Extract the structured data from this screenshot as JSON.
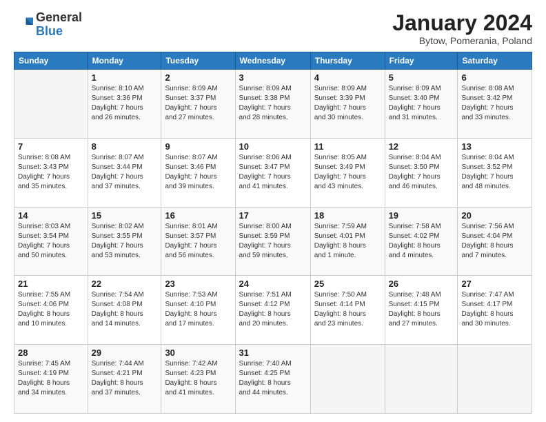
{
  "header": {
    "logo_general": "General",
    "logo_blue": "Blue",
    "month_title": "January 2024",
    "subtitle": "Bytow, Pomerania, Poland"
  },
  "weekdays": [
    "Sunday",
    "Monday",
    "Tuesday",
    "Wednesday",
    "Thursday",
    "Friday",
    "Saturday"
  ],
  "weeks": [
    [
      {
        "day": "",
        "detail": ""
      },
      {
        "day": "1",
        "detail": "Sunrise: 8:10 AM\nSunset: 3:36 PM\nDaylight: 7 hours\nand 26 minutes."
      },
      {
        "day": "2",
        "detail": "Sunrise: 8:09 AM\nSunset: 3:37 PM\nDaylight: 7 hours\nand 27 minutes."
      },
      {
        "day": "3",
        "detail": "Sunrise: 8:09 AM\nSunset: 3:38 PM\nDaylight: 7 hours\nand 28 minutes."
      },
      {
        "day": "4",
        "detail": "Sunrise: 8:09 AM\nSunset: 3:39 PM\nDaylight: 7 hours\nand 30 minutes."
      },
      {
        "day": "5",
        "detail": "Sunrise: 8:09 AM\nSunset: 3:40 PM\nDaylight: 7 hours\nand 31 minutes."
      },
      {
        "day": "6",
        "detail": "Sunrise: 8:08 AM\nSunset: 3:42 PM\nDaylight: 7 hours\nand 33 minutes."
      }
    ],
    [
      {
        "day": "7",
        "detail": "Sunrise: 8:08 AM\nSunset: 3:43 PM\nDaylight: 7 hours\nand 35 minutes."
      },
      {
        "day": "8",
        "detail": "Sunrise: 8:07 AM\nSunset: 3:44 PM\nDaylight: 7 hours\nand 37 minutes."
      },
      {
        "day": "9",
        "detail": "Sunrise: 8:07 AM\nSunset: 3:46 PM\nDaylight: 7 hours\nand 39 minutes."
      },
      {
        "day": "10",
        "detail": "Sunrise: 8:06 AM\nSunset: 3:47 PM\nDaylight: 7 hours\nand 41 minutes."
      },
      {
        "day": "11",
        "detail": "Sunrise: 8:05 AM\nSunset: 3:49 PM\nDaylight: 7 hours\nand 43 minutes."
      },
      {
        "day": "12",
        "detail": "Sunrise: 8:04 AM\nSunset: 3:50 PM\nDaylight: 7 hours\nand 46 minutes."
      },
      {
        "day": "13",
        "detail": "Sunrise: 8:04 AM\nSunset: 3:52 PM\nDaylight: 7 hours\nand 48 minutes."
      }
    ],
    [
      {
        "day": "14",
        "detail": "Sunrise: 8:03 AM\nSunset: 3:54 PM\nDaylight: 7 hours\nand 50 minutes."
      },
      {
        "day": "15",
        "detail": "Sunrise: 8:02 AM\nSunset: 3:55 PM\nDaylight: 7 hours\nand 53 minutes."
      },
      {
        "day": "16",
        "detail": "Sunrise: 8:01 AM\nSunset: 3:57 PM\nDaylight: 7 hours\nand 56 minutes."
      },
      {
        "day": "17",
        "detail": "Sunrise: 8:00 AM\nSunset: 3:59 PM\nDaylight: 7 hours\nand 59 minutes."
      },
      {
        "day": "18",
        "detail": "Sunrise: 7:59 AM\nSunset: 4:01 PM\nDaylight: 8 hours\nand 1 minute."
      },
      {
        "day": "19",
        "detail": "Sunrise: 7:58 AM\nSunset: 4:02 PM\nDaylight: 8 hours\nand 4 minutes."
      },
      {
        "day": "20",
        "detail": "Sunrise: 7:56 AM\nSunset: 4:04 PM\nDaylight: 8 hours\nand 7 minutes."
      }
    ],
    [
      {
        "day": "21",
        "detail": "Sunrise: 7:55 AM\nSunset: 4:06 PM\nDaylight: 8 hours\nand 10 minutes."
      },
      {
        "day": "22",
        "detail": "Sunrise: 7:54 AM\nSunset: 4:08 PM\nDaylight: 8 hours\nand 14 minutes."
      },
      {
        "day": "23",
        "detail": "Sunrise: 7:53 AM\nSunset: 4:10 PM\nDaylight: 8 hours\nand 17 minutes."
      },
      {
        "day": "24",
        "detail": "Sunrise: 7:51 AM\nSunset: 4:12 PM\nDaylight: 8 hours\nand 20 minutes."
      },
      {
        "day": "25",
        "detail": "Sunrise: 7:50 AM\nSunset: 4:14 PM\nDaylight: 8 hours\nand 23 minutes."
      },
      {
        "day": "26",
        "detail": "Sunrise: 7:48 AM\nSunset: 4:15 PM\nDaylight: 8 hours\nand 27 minutes."
      },
      {
        "day": "27",
        "detail": "Sunrise: 7:47 AM\nSunset: 4:17 PM\nDaylight: 8 hours\nand 30 minutes."
      }
    ],
    [
      {
        "day": "28",
        "detail": "Sunrise: 7:45 AM\nSunset: 4:19 PM\nDaylight: 8 hours\nand 34 minutes."
      },
      {
        "day": "29",
        "detail": "Sunrise: 7:44 AM\nSunset: 4:21 PM\nDaylight: 8 hours\nand 37 minutes."
      },
      {
        "day": "30",
        "detail": "Sunrise: 7:42 AM\nSunset: 4:23 PM\nDaylight: 8 hours\nand 41 minutes."
      },
      {
        "day": "31",
        "detail": "Sunrise: 7:40 AM\nSunset: 4:25 PM\nDaylight: 8 hours\nand 44 minutes."
      },
      {
        "day": "",
        "detail": ""
      },
      {
        "day": "",
        "detail": ""
      },
      {
        "day": "",
        "detail": ""
      }
    ]
  ]
}
